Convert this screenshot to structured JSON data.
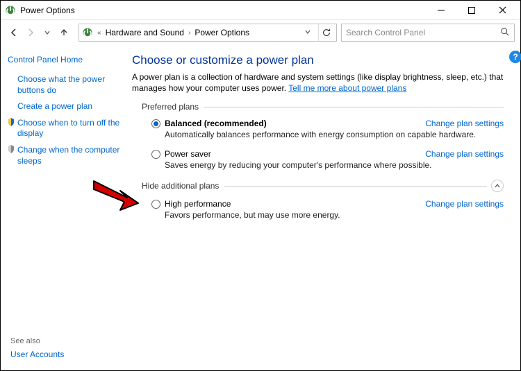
{
  "window": {
    "title": "Power Options"
  },
  "breadcrumb": {
    "parent": "Hardware and Sound",
    "current": "Power Options"
  },
  "search": {
    "placeholder": "Search Control Panel"
  },
  "sidebar": {
    "home": "Control Panel Home",
    "links": [
      "Choose what the power buttons do",
      "Create a power plan",
      "Choose when to turn off the display",
      "Change when the computer sleeps"
    ],
    "see_also_hdr": "See also",
    "see_also_link": "User Accounts"
  },
  "main": {
    "title": "Choose or customize a power plan",
    "intro": "A power plan is a collection of hardware and system settings (like display brightness, sleep, etc.) that manages how your computer uses power. ",
    "intro_link": "Tell me more about power plans",
    "preferred_hdr": "Preferred plans",
    "hide_hdr": "Hide additional plans",
    "change_label": "Change plan settings",
    "plans": {
      "balanced": {
        "name": "Balanced (recommended)",
        "desc": "Automatically balances performance with energy consumption on capable hardware."
      },
      "saver": {
        "name": "Power saver",
        "desc": "Saves energy by reducing your computer's performance where possible."
      },
      "high": {
        "name": "High performance",
        "desc": "Favors performance, but may use more energy."
      }
    }
  }
}
